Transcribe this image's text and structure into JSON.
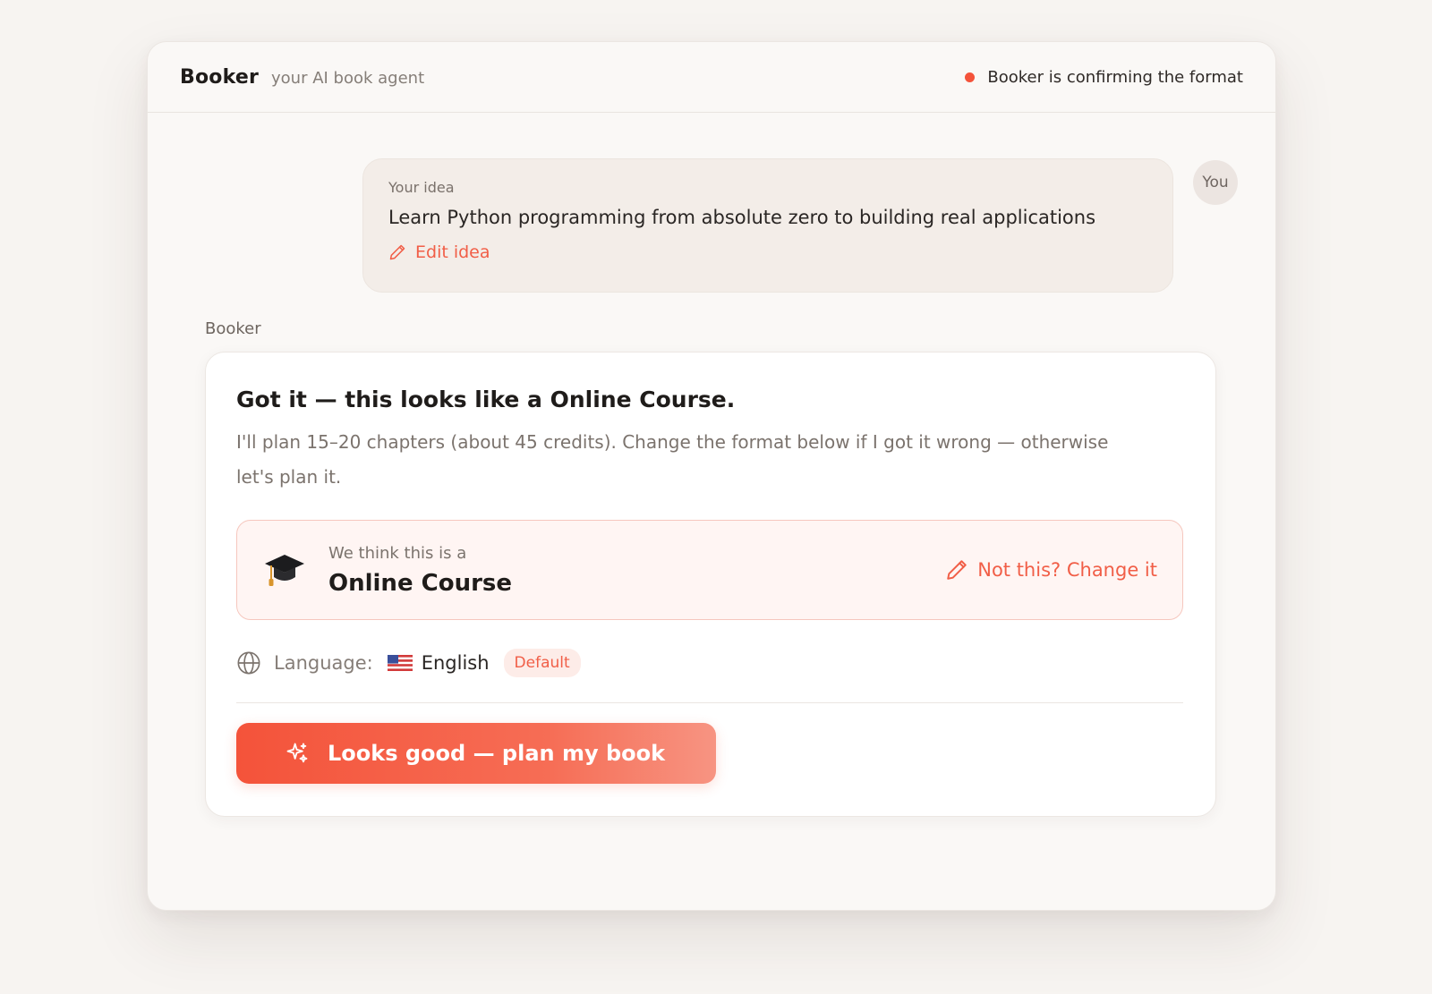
{
  "app": {
    "name": "Booker",
    "tagline": "your AI book agent"
  },
  "status": {
    "text": "Booker is confirming the format",
    "dot_color": "#f4533a"
  },
  "user_message": {
    "label": "Your idea",
    "text": "Learn Python programming from absolute zero to building real applications",
    "edit_label": "Edit idea",
    "avatar_label": "You"
  },
  "agent": {
    "label": "Booker",
    "title": "Got it — this looks like a Online Course.",
    "description": "I'll plan 15–20 chapters (about 45 credits). Change the format below if I got it wrong — otherwise let's plan it.",
    "format": {
      "intro": "We think this is a",
      "name": "Online Course",
      "icon": "graduation-cap-icon",
      "change_label": "Not this? Change it"
    },
    "language": {
      "label": "Language:",
      "flag": "us-flag-icon",
      "value": "English",
      "badge": "Default"
    },
    "cta_label": "Looks good — plan my book"
  },
  "colors": {
    "accent": "#f4533a",
    "link": "#f15e47",
    "background": "#f7f4f1"
  }
}
